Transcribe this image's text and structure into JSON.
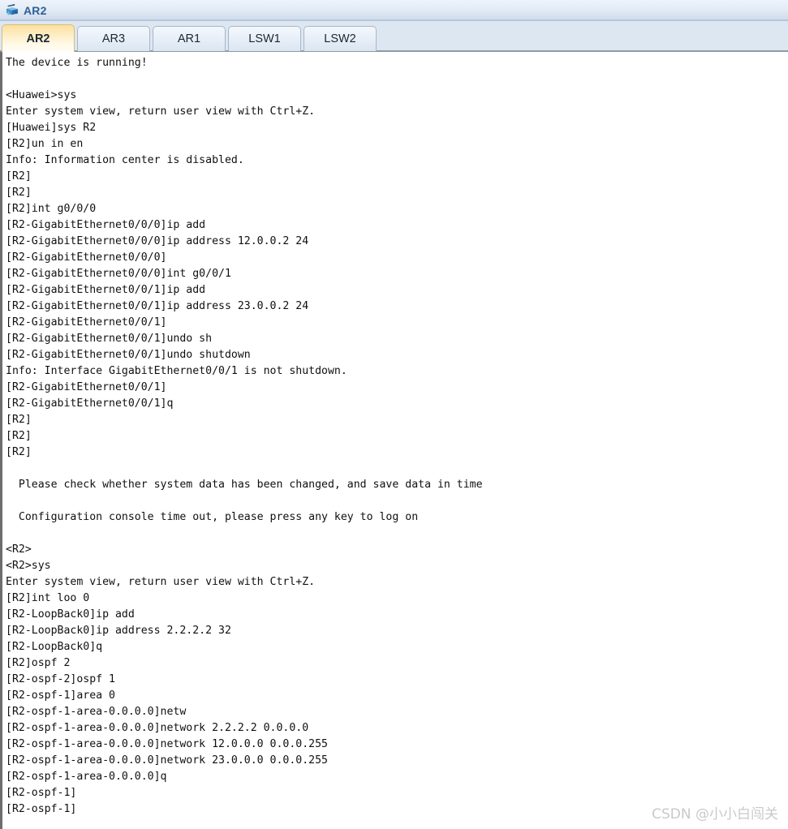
{
  "window": {
    "title": "AR2",
    "icon": "router-icon"
  },
  "tabs": {
    "items": [
      {
        "label": "AR2",
        "active": true
      },
      {
        "label": "AR3",
        "active": false
      },
      {
        "label": "AR1",
        "active": false
      },
      {
        "label": "LSW1",
        "active": false
      },
      {
        "label": "LSW2",
        "active": false
      }
    ],
    "active_index": 0
  },
  "console": {
    "lines": [
      "The device is running!",
      "",
      "<Huawei>sys",
      "Enter system view, return user view with Ctrl+Z.",
      "[Huawei]sys R2",
      "[R2]un in en",
      "Info: Information center is disabled.",
      "[R2]",
      "[R2]",
      "[R2]int g0/0/0",
      "[R2-GigabitEthernet0/0/0]ip add",
      "[R2-GigabitEthernet0/0/0]ip address 12.0.0.2 24",
      "[R2-GigabitEthernet0/0/0]",
      "[R2-GigabitEthernet0/0/0]int g0/0/1",
      "[R2-GigabitEthernet0/0/1]ip add",
      "[R2-GigabitEthernet0/0/1]ip address 23.0.0.2 24",
      "[R2-GigabitEthernet0/0/1]",
      "[R2-GigabitEthernet0/0/1]undo sh",
      "[R2-GigabitEthernet0/0/1]undo shutdown",
      "Info: Interface GigabitEthernet0/0/1 is not shutdown.",
      "[R2-GigabitEthernet0/0/1]",
      "[R2-GigabitEthernet0/0/1]q",
      "[R2]",
      "[R2]",
      "[R2]",
      "",
      "  Please check whether system data has been changed, and save data in time",
      "",
      "  Configuration console time out, please press any key to log on",
      "",
      "<R2>",
      "<R2>sys",
      "Enter system view, return user view with Ctrl+Z.",
      "[R2]int loo 0",
      "[R2-LoopBack0]ip add",
      "[R2-LoopBack0]ip address 2.2.2.2 32",
      "[R2-LoopBack0]q",
      "[R2]ospf 2",
      "[R2-ospf-2]ospf 1",
      "[R2-ospf-1]area 0",
      "[R2-ospf-1-area-0.0.0.0]netw",
      "[R2-ospf-1-area-0.0.0.0]network 2.2.2.2 0.0.0.0",
      "[R2-ospf-1-area-0.0.0.0]network 12.0.0.0 0.0.0.255",
      "[R2-ospf-1-area-0.0.0.0]network 23.0.0.0 0.0.0.255",
      "[R2-ospf-1-area-0.0.0.0]q",
      "[R2-ospf-1]",
      "[R2-ospf-1]"
    ]
  },
  "watermark": {
    "text": "CSDN @小小白闯关"
  },
  "colors": {
    "title_text": "#2f5f97",
    "tab_active_bg": "#fdedc4",
    "tab_inactive_bg": "#e6eef7",
    "tab_strip_bg": "#dde7f2",
    "console_bg": "#ffffff",
    "console_text": "#101010",
    "console_border": "#6d6d6d",
    "watermark": "#c9c9c9"
  }
}
